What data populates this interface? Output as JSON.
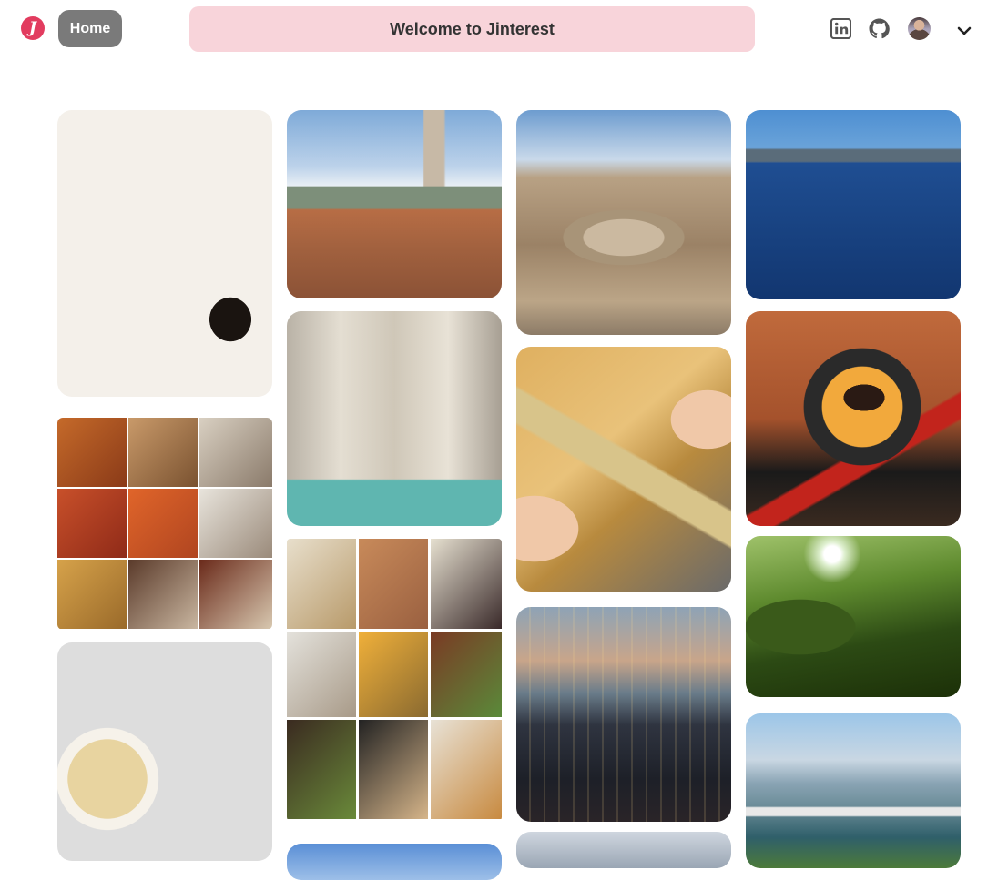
{
  "header": {
    "logo_letter": "J",
    "home_label": "Home",
    "welcome_text": "Welcome to Jinterest",
    "icons": [
      "linkedin-icon",
      "github-icon",
      "avatar",
      "chevron-down-icon"
    ]
  },
  "colors": {
    "brand": "#e23c5f",
    "home_button": "#7a7a7a",
    "welcome_banner": "#f8d4da"
  },
  "pins": [
    {
      "column": 1,
      "subject": "breakfast"
    },
    {
      "column": 1,
      "subject": "food-collage"
    },
    {
      "column": 1,
      "subject": "noodle-bowls"
    },
    {
      "column": 2,
      "subject": "florence"
    },
    {
      "column": 2,
      "subject": "trevi-fountain"
    },
    {
      "column": 2,
      "subject": "taiwanese-food-collage"
    },
    {
      "column": 2,
      "subject": "sky"
    },
    {
      "column": 3,
      "subject": "colosseum"
    },
    {
      "column": 3,
      "subject": "stationery"
    },
    {
      "column": 3,
      "subject": "city-night"
    },
    {
      "column": 3,
      "subject": "portrait"
    },
    {
      "column": 4,
      "subject": "lake"
    },
    {
      "column": 4,
      "subject": "pudding"
    },
    {
      "column": 4,
      "subject": "forest"
    },
    {
      "column": 4,
      "subject": "harbor"
    }
  ]
}
